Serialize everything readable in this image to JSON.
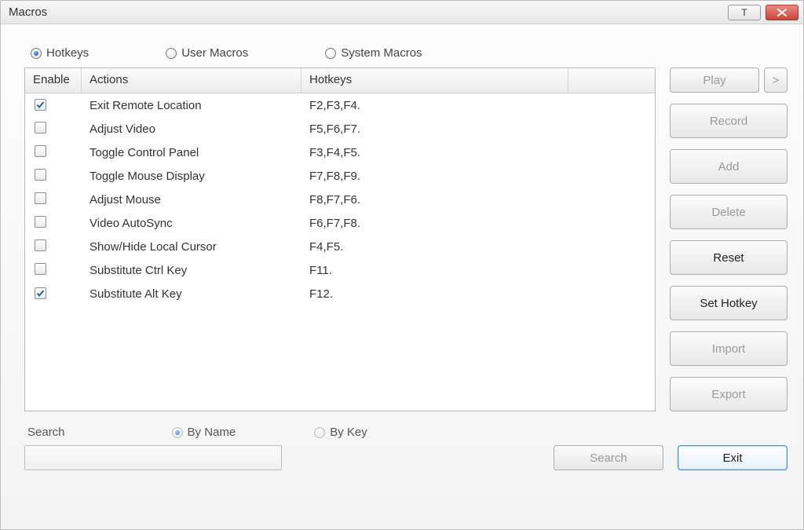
{
  "window": {
    "title": "Macros",
    "t_button": "T"
  },
  "tabs": {
    "hotkeys": "Hotkeys",
    "user_macros": "User Macros",
    "system_macros": "System Macros",
    "selected": "hotkeys"
  },
  "grid": {
    "headers": {
      "enable": "Enable",
      "actions": "Actions",
      "hotkeys": "Hotkeys"
    },
    "rows": [
      {
        "enabled": true,
        "action": "Exit Remote Location",
        "hotkey": "F2,F3,F4."
      },
      {
        "enabled": false,
        "action": "Adjust Video",
        "hotkey": "F5,F6,F7."
      },
      {
        "enabled": false,
        "action": "Toggle Control Panel",
        "hotkey": "F3,F4,F5."
      },
      {
        "enabled": false,
        "action": "Toggle Mouse Display",
        "hotkey": "F7,F8,F9."
      },
      {
        "enabled": false,
        "action": "Adjust Mouse",
        "hotkey": "F8,F7,F6."
      },
      {
        "enabled": false,
        "action": "Video AutoSync",
        "hotkey": "F6,F7,F8."
      },
      {
        "enabled": false,
        "action": "Show/Hide Local Cursor",
        "hotkey": "F4,F5."
      },
      {
        "enabled": false,
        "action": "Substitute Ctrl Key",
        "hotkey": "F11."
      },
      {
        "enabled": true,
        "action": "Substitute Alt Key",
        "hotkey": "F12."
      }
    ]
  },
  "buttons": {
    "play": "Play",
    "play_more": ">",
    "record": "Record",
    "add": "Add",
    "delete": "Delete",
    "reset": "Reset",
    "set_hotkey": "Set Hotkey",
    "import": "Import",
    "export": "Export",
    "search": "Search",
    "exit": "Exit"
  },
  "search": {
    "label": "Search",
    "by_name": "By Name",
    "by_key": "By Key",
    "value": ""
  }
}
